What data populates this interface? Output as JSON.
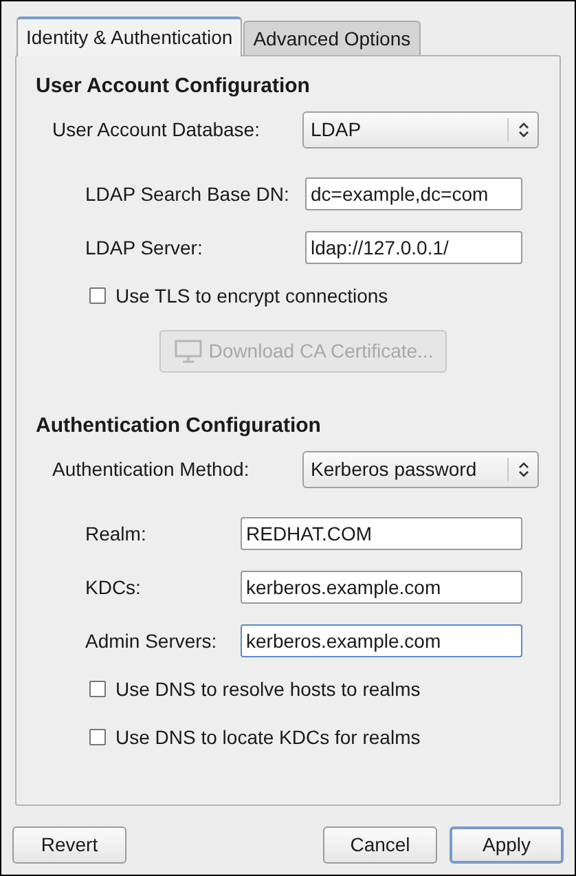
{
  "tabs": [
    {
      "label": "Identity & Authentication",
      "selected": true
    },
    {
      "label": "Advanced Options",
      "selected": false
    }
  ],
  "sections": [
    {
      "title": "User Account Configuration",
      "rows": [
        {
          "kind": "select",
          "label": "User Account Database:",
          "value": "LDAP"
        },
        {
          "kind": "field",
          "label": "LDAP Search Base DN:",
          "value": "dc=example,dc=com",
          "focused": false
        },
        {
          "kind": "field",
          "label": "LDAP Server:",
          "value": "ldap://127.0.0.1/",
          "focused": false
        },
        {
          "kind": "checkbox",
          "label": "Use TLS to encrypt connections",
          "checked": false
        },
        {
          "kind": "button",
          "label": "Download CA Certificate...",
          "disabled": true
        }
      ]
    },
    {
      "title": "Authentication Configuration",
      "rows": [
        {
          "kind": "select",
          "label": "Authentication Method:",
          "value": "Kerberos password"
        },
        {
          "kind": "field",
          "label": "Realm:",
          "value": "REDHAT.COM",
          "focused": false
        },
        {
          "kind": "field",
          "label": "KDCs:",
          "value": "kerberos.example.com",
          "focused": false
        },
        {
          "kind": "field",
          "label": "Admin Servers:",
          "value": "kerberos.example.com",
          "focused": true
        },
        {
          "kind": "checkbox",
          "label": "Use DNS to resolve hosts to realms",
          "checked": false
        },
        {
          "kind": "checkbox",
          "label": "Use DNS to locate KDCs for realms",
          "checked": false
        }
      ]
    }
  ],
  "buttons": [
    {
      "label": "Revert",
      "default": false
    },
    {
      "label": "Cancel",
      "default": false
    },
    {
      "label": "Apply",
      "default": true
    }
  ]
}
